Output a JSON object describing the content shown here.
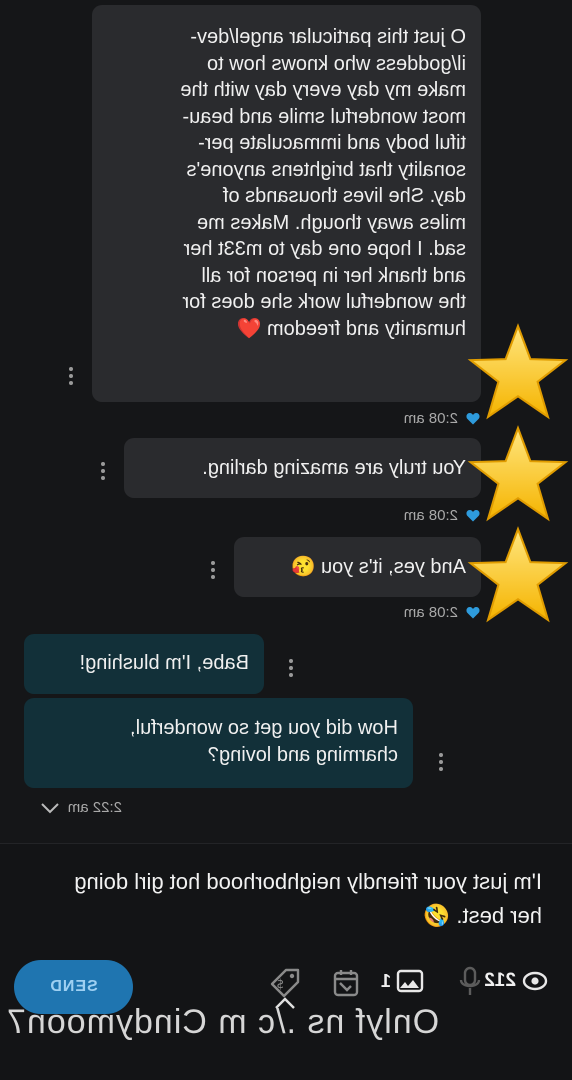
{
  "colors": {
    "background": "#151618",
    "bubble_dark": "#2a2b2e",
    "bubble_teal": "#123039",
    "send_button": "#1f75b0",
    "heart_status": "#2e9bdc"
  },
  "messages": [
    {
      "text": "O just this particular angel/dev-\nil/goddess who knows how to\nmake my day every day with the\nmost wonderful smile and beau-\ntiful body and immaculate per-\nsonality that brightens anyone's\nday. She lives thousands of\nmiles away though. Makes me\nsad. I hope one day to m33t her\nand thank her in person for all\nthe wonderful work she does for\nhumanity and freedom ❤️",
      "time": "2:08 am"
    },
    {
      "text": "You truly are amazing darling.",
      "time": "2:08 am"
    },
    {
      "text": "And yes, it's you 😘",
      "time": "2:08 am"
    },
    {
      "text": "Babe, I'm blushing!"
    },
    {
      "text": "How did you get so wonderful,\ncharming and loving?",
      "time": "2:22 am"
    }
  ],
  "composer": {
    "text": "I'm just your friendly neighborhood hot girl doing\nher best. 🤣",
    "send_label": "SEND"
  },
  "toolbar": {
    "views_count": "212",
    "media_count": "1",
    "icons": [
      "eye-icon",
      "microphone-icon",
      "media-icon",
      "calendar-icon",
      "price-tag-icon"
    ]
  },
  "watermark": "Onlyf ns ./c m Cindymoon7"
}
